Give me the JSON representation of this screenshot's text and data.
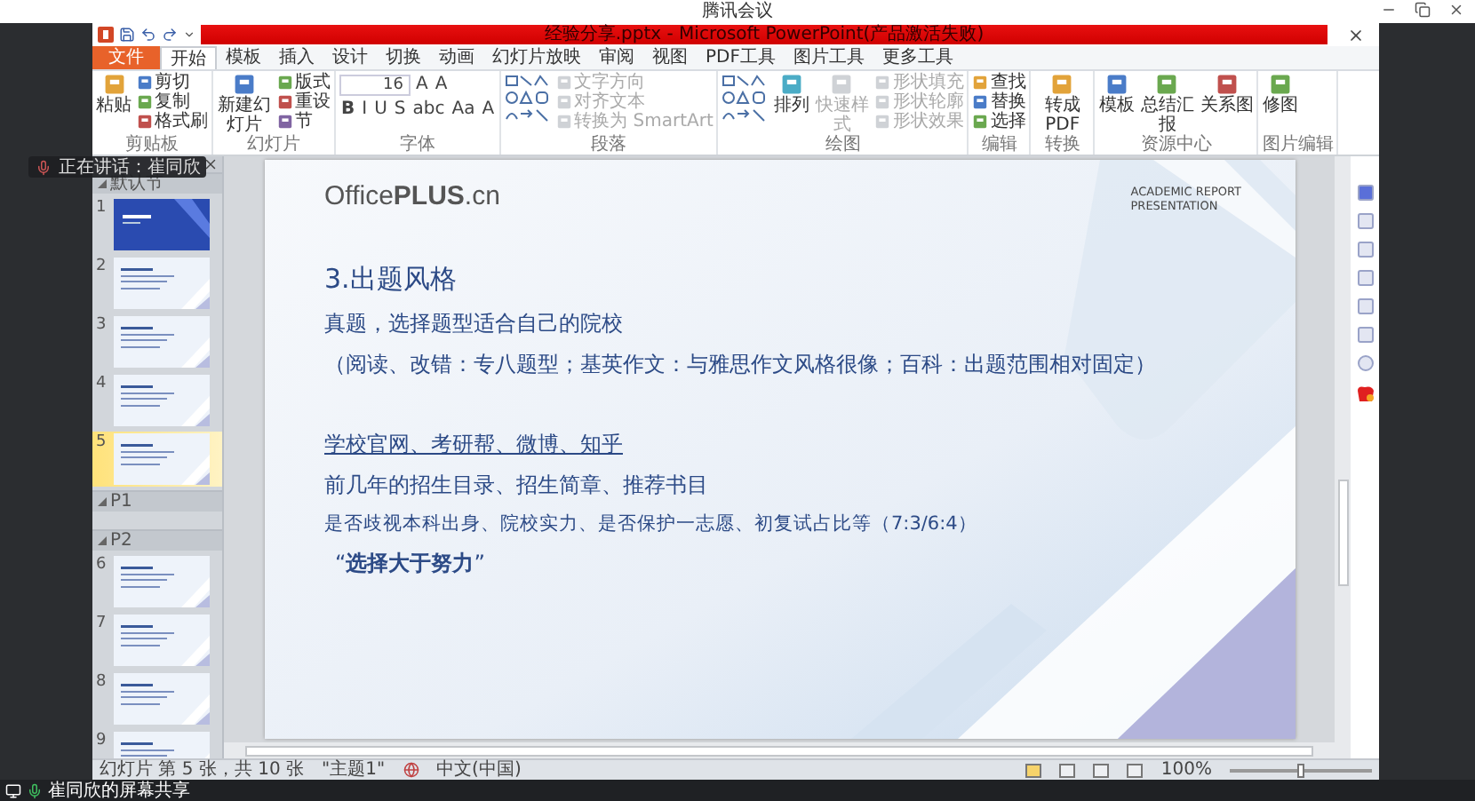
{
  "meeting": {
    "title": "腾讯会议",
    "speaker": "正在讲话：崔同欣",
    "share": "崔同欣的屏幕共享"
  },
  "ppt": {
    "title": "经验分享.pptx - Microsoft PowerPoint(产品激活失败)",
    "tabs": [
      {
        "label": "文件",
        "kind": "file",
        "selected": false
      },
      {
        "label": "开始",
        "kind": "tab",
        "selected": true
      },
      {
        "label": "模板",
        "kind": "tab",
        "selected": false
      },
      {
        "label": "插入",
        "kind": "tab",
        "selected": false
      },
      {
        "label": "设计",
        "kind": "tab",
        "selected": false
      },
      {
        "label": "切换",
        "kind": "tab",
        "selected": false
      },
      {
        "label": "动画",
        "kind": "tab",
        "selected": false
      },
      {
        "label": "幻灯片放映",
        "kind": "tab",
        "selected": false
      },
      {
        "label": "审阅",
        "kind": "tab",
        "selected": false
      },
      {
        "label": "视图",
        "kind": "tab",
        "selected": false
      },
      {
        "label": "PDF工具",
        "kind": "tab",
        "selected": false
      },
      {
        "label": "图片工具",
        "kind": "tab",
        "selected": false
      },
      {
        "label": "更多工具",
        "kind": "tab",
        "selected": false
      }
    ],
    "ribbon": [
      {
        "label": "剪贴板",
        "columns": [
          {
            "kind": "large",
            "label": "粘贴",
            "disabled": false
          },
          {
            "kind": "stack",
            "items": [
              {
                "label": "剪切",
                "disabled": false
              },
              {
                "label": "复制",
                "disabled": false
              },
              {
                "label": "格式刷",
                "disabled": false
              }
            ]
          }
        ]
      },
      {
        "label": "幻灯片",
        "columns": [
          {
            "kind": "large",
            "label": "新建幻灯片",
            "disabled": false
          },
          {
            "kind": "stack",
            "items": [
              {
                "label": "版式",
                "disabled": false
              },
              {
                "label": "重设",
                "disabled": false
              },
              {
                "label": "节",
                "disabled": false
              }
            ]
          }
        ]
      },
      {
        "label": "字体",
        "columns": [
          {
            "kind": "font",
            "size": "16",
            "row1": [
              "A",
              "A"
            ],
            "row2": [
              "B",
              "I",
              "U",
              "S",
              "abc",
              "Aa",
              "A"
            ]
          }
        ]
      },
      {
        "label": "段落",
        "columns": [
          {
            "kind": "gallery"
          },
          {
            "kind": "stack",
            "items": [
              {
                "label": "文字方向",
                "disabled": true
              },
              {
                "label": "对齐文本",
                "disabled": true
              },
              {
                "label": "转换为 SmartArt",
                "disabled": true
              }
            ]
          }
        ]
      },
      {
        "label": "绘图",
        "columns": [
          {
            "kind": "gallery"
          },
          {
            "kind": "large",
            "label": "排列",
            "disabled": false
          },
          {
            "kind": "large",
            "label": "快速样式",
            "disabled": true
          },
          {
            "kind": "stack",
            "items": [
              {
                "label": "形状填充",
                "disabled": true
              },
              {
                "label": "形状轮廓",
                "disabled": true
              },
              {
                "label": "形状效果",
                "disabled": true
              }
            ]
          }
        ]
      },
      {
        "label": "编辑",
        "columns": [
          {
            "kind": "stack",
            "items": [
              {
                "label": "查找",
                "disabled": false
              },
              {
                "label": "替换",
                "disabled": false
              },
              {
                "label": "选择",
                "disabled": false
              }
            ]
          }
        ]
      },
      {
        "label": "转换",
        "columns": [
          {
            "kind": "large",
            "label": "转成PDF",
            "disabled": false
          }
        ]
      },
      {
        "label": "资源中心",
        "columns": [
          {
            "kind": "large",
            "label": "模板",
            "disabled": false
          },
          {
            "kind": "large",
            "label": "总结汇报",
            "disabled": false
          },
          {
            "kind": "large",
            "label": "关系图",
            "disabled": false
          }
        ]
      },
      {
        "label": "图片编辑",
        "columns": [
          {
            "kind": "large",
            "label": "修图",
            "disabled": false
          }
        ]
      }
    ],
    "sections": [
      {
        "name": "默认节",
        "slides": [
          {
            "number": "1",
            "kind": "dark",
            "selected": false
          },
          {
            "number": "2",
            "kind": "light",
            "selected": false
          },
          {
            "number": "3",
            "kind": "light",
            "selected": false
          },
          {
            "number": "4",
            "kind": "light",
            "selected": false
          },
          {
            "number": "5",
            "kind": "light",
            "selected": true
          }
        ]
      },
      {
        "name": "P1"
      },
      {
        "name": "P2",
        "slides": [
          {
            "number": "6",
            "kind": "light",
            "selected": false
          },
          {
            "number": "7",
            "kind": "light",
            "selected": false
          },
          {
            "number": "8",
            "kind": "light",
            "selected": false
          },
          {
            "number": "9",
            "kind": "light",
            "selected": false
          }
        ]
      }
    ],
    "slide": {
      "logo": "Office**PLUS**.cn",
      "tagline": "ACADEMIC REPORT\nPRESENTATION",
      "lines": [
        {
          "kind": "heading",
          "text": "3.出题风格"
        },
        {
          "kind": "body",
          "text": "真题，选择题型适合自己的院校"
        },
        {
          "kind": "body",
          "text": "（阅读、改错：专八题型；基英作文：与雅思作文风格很像；百科：出题范围相对固定）"
        },
        {
          "kind": "link",
          "text": "学校官网、考研帮、微博、知乎"
        },
        {
          "kind": "body",
          "text": "前几年的招生目录、招生简章、推荐书目"
        },
        {
          "kind": "small",
          "text": "是否歧视本科出身、院校实力、是否保护一志愿、初复试占比等（7:3/6:4）"
        },
        {
          "kind": "quote",
          "text": "“**选择大于努力**”"
        }
      ]
    },
    "status": {
      "slide": "幻灯片 第 5 张，共 10 张",
      "theme": "\"主题1\"",
      "language": "中文(中国)",
      "zoom": "100%",
      "zoom_slider": {
        "level": 0.5
      }
    }
  }
}
